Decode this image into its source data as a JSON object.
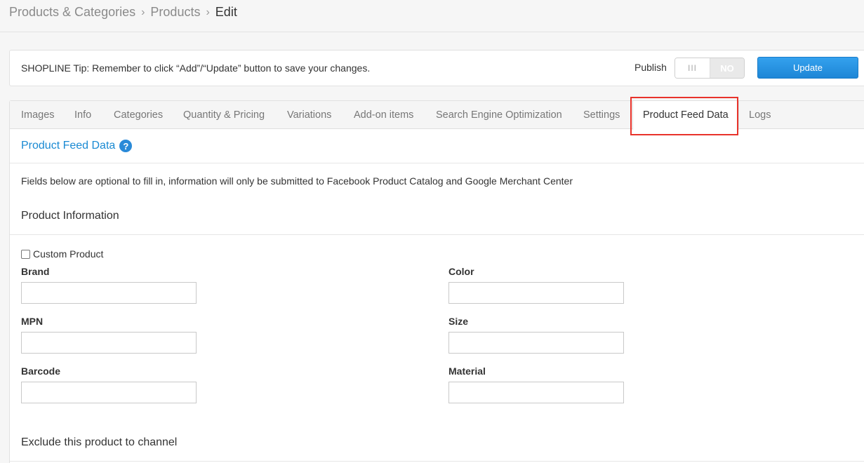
{
  "breadcrumb": {
    "level1": "Products & Categories",
    "level2": "Products",
    "current": "Edit",
    "separator": "›"
  },
  "tip": {
    "text": "SHOPLINE Tip: Remember to click “Add”/“Update” button to save your changes."
  },
  "publish": {
    "label": "Publish",
    "state": "NO",
    "handle": "III"
  },
  "update_button": "Update",
  "tabs": [
    {
      "label": "Images"
    },
    {
      "label": "Info"
    },
    {
      "label": "Categories"
    },
    {
      "label": "Quantity & Pricing"
    },
    {
      "label": "Variations"
    },
    {
      "label": "Add-on items"
    },
    {
      "label": "Search Engine Optimization"
    },
    {
      "label": "Settings"
    },
    {
      "label": "Product Feed Data"
    },
    {
      "label": "Logs"
    }
  ],
  "active_tab": "Product Feed Data",
  "section": {
    "title": "Product Feed Data",
    "help": "?",
    "description": "Fields below are optional to fill in, information will only be submitted to Facebook Product Catalog and Google Merchant Center",
    "product_info_heading": "Product Information",
    "custom_product_label": "Custom Product",
    "exclude_heading": "Exclude this product to channel"
  },
  "fields": {
    "brand": {
      "label": "Brand",
      "value": ""
    },
    "mpn": {
      "label": "MPN",
      "value": ""
    },
    "barcode": {
      "label": "Barcode",
      "value": ""
    },
    "color": {
      "label": "Color",
      "value": ""
    },
    "size": {
      "label": "Size",
      "value": ""
    },
    "material": {
      "label": "Material",
      "value": ""
    }
  },
  "colors": {
    "accent": "#1a8ad3",
    "button": "#2a92e0",
    "highlight": "#e8332b"
  }
}
